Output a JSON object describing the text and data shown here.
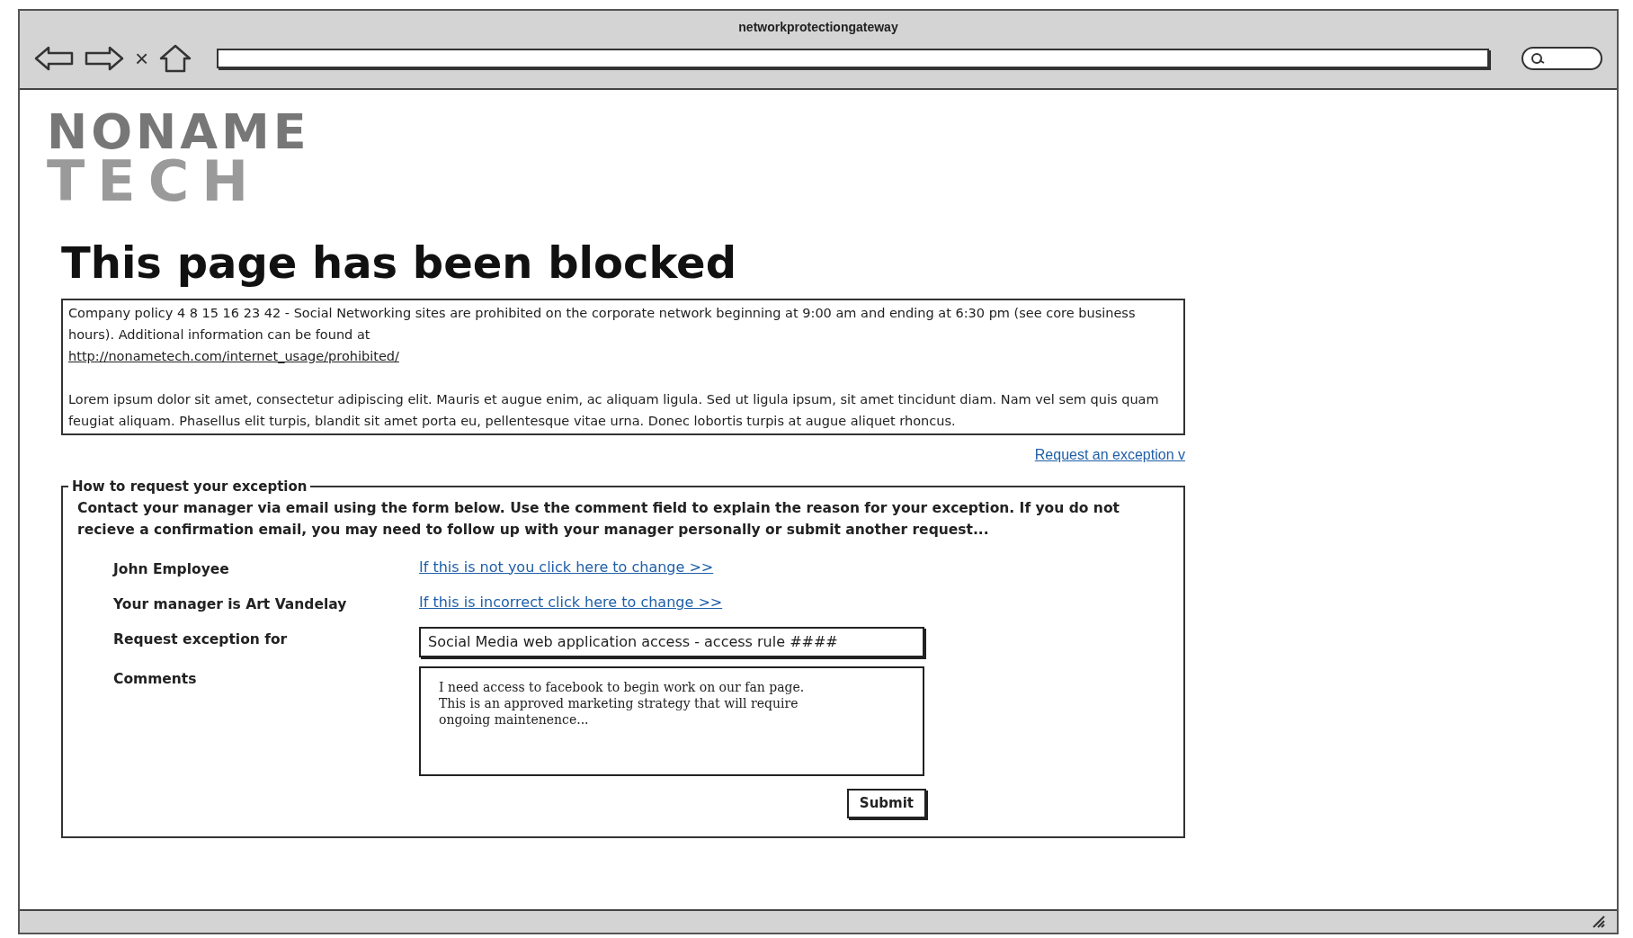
{
  "window": {
    "title": "networkprotectiongateway"
  },
  "toolbar": {
    "buttons": [
      {
        "kind": "back"
      },
      {
        "kind": "forward"
      },
      {
        "kind": "stop",
        "label": "×"
      },
      {
        "kind": "home"
      }
    ]
  },
  "logo": {
    "line_1": "NONAME",
    "line_2": "TECH"
  },
  "heading": "This page has been blocked",
  "notice": {
    "policy": "Company policy 4 8 15 16 23 42 - Social Networking sites are prohibited on the corporate network beginning at 9:00 am and ending at 6:30 pm (see core business hours). Additional information can be found at",
    "url": "http://nonametech.com/internet_usage/prohibited/",
    "body": "Lorem ipsum dolor sit amet, consectetur adipiscing elit. Mauris et augue enim, ac aliquam ligula. Sed ut ligula ipsum, sit amet tincidunt diam. Nam vel sem quis quam feugiat aliquam. Phasellus elit turpis, blandit sit amet porta eu, pellentesque vitae urna. Donec lobortis turpis at augue aliquet rhoncus."
  },
  "request_link": "Request an exception v",
  "form": {
    "legend": "How to request your exception",
    "intro": "Contact your manager via email using the form below. Use the comment field to explain the reason for your exception. If you do not recieve a confirmation email, you may need to follow up with your manager personally or submit another request...",
    "rows": [
      {
        "kind": "link",
        "label": "John Employee",
        "value": "If this is not you click here to change >>"
      },
      {
        "kind": "link",
        "label": "Your manager is Art Vandelay",
        "value": "If this is incorrect click here to change >>"
      },
      {
        "kind": "input",
        "label": "Request exception for",
        "value": "Social Media web application access - access rule ####"
      },
      {
        "kind": "textarea",
        "label": "Comments",
        "value": "I need access to facebook to begin work on our fan page.\nThis is an approved marketing strategy that will require\nongoing maintenence..."
      }
    ],
    "submit": "Submit"
  }
}
